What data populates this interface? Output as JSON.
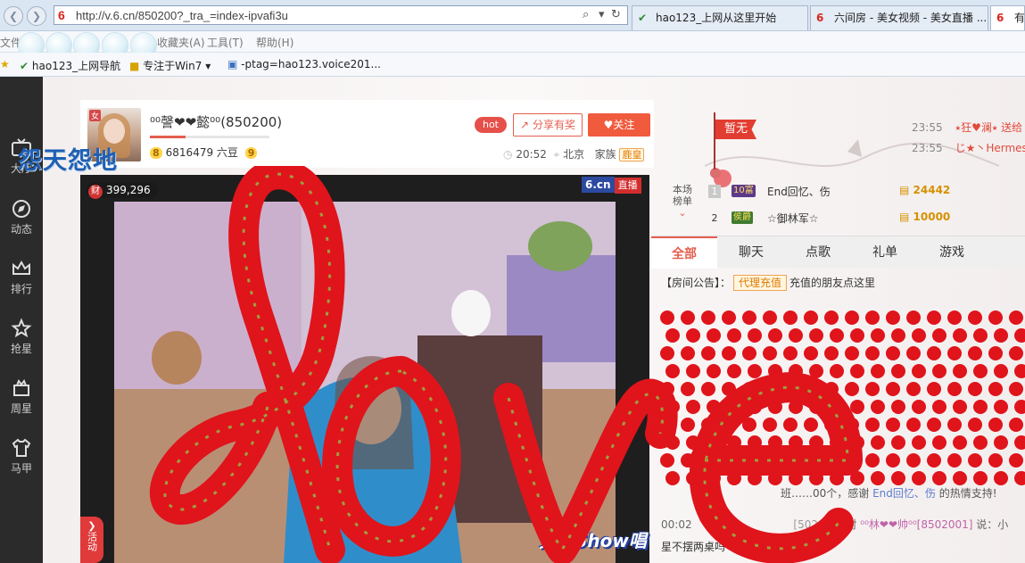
{
  "browser": {
    "url": "http://v.6.cn/850200?_tra_=index-ipvafi3u",
    "tabs": [
      {
        "icon": "hao123-icon",
        "label": "hao123_上网从这里开始"
      },
      {
        "icon": "6cn-icon",
        "label": "六间房 - 美女视频 - 美女直播 ..."
      },
      {
        "icon": "6cn-icon",
        "label": "有颜..."
      }
    ],
    "menu": {
      "file": "文件",
      "favorites": "收藏夹(A)",
      "tools": "工具(T)",
      "help": "帮助(H)"
    },
    "favorites": [
      {
        "label": "hao123_上网导航"
      },
      {
        "label": "专注于Win7"
      },
      {
        "label": "-ptag=hao123.voice201..."
      }
    ]
  },
  "overlay_watermark": "怨天怨地",
  "nav": [
    {
      "label": "大厅"
    },
    {
      "label": "动态"
    },
    {
      "label": "排行"
    },
    {
      "label": "抢星"
    },
    {
      "label": "周星"
    },
    {
      "label": "马甲"
    }
  ],
  "anchor": {
    "name": "⁰⁰謦❤❤懿⁰⁰(850200)",
    "level_left": "8",
    "level_right": "9",
    "beans": "6816479 六豆",
    "level_progress": 0.3,
    "hot": "hot",
    "share": "分享有奖",
    "follow": "关注",
    "time": "20:52",
    "location": "北京",
    "family_label": "家族",
    "family_badge": "鹿皇"
  },
  "flag_label": "暂无",
  "chat_top": [
    {
      "time": "23:55",
      "text": "⭑狂♥澜⭑ 送给"
    },
    {
      "time": "23:55",
      "text": "じ★丶Hermes..."
    }
  ],
  "video": {
    "viewers": "399,296",
    "viewer_icon": "财",
    "logo": "6.cn",
    "live": "直播",
    "activity": "活动",
    "show_logo": "秀场Show唱"
  },
  "rank": {
    "title": "本场榜单",
    "rows": [
      {
        "no": "1",
        "badge": "10富",
        "name": "End回忆、伤",
        "amount": "24442"
      },
      {
        "no": "2",
        "badge": "侯爵",
        "name": "☆御林军☆",
        "amount": "10000"
      }
    ]
  },
  "chat_tabs": [
    {
      "label": "全部"
    },
    {
      "label": "聊天"
    },
    {
      "label": "点歌"
    },
    {
      "label": "礼单"
    },
    {
      "label": "游戏"
    }
  ],
  "notice": {
    "prefix": "【房间公告】：",
    "agent": "代理充值",
    "text": "充值的朋友点这里"
  },
  "gift_line": {
    "prefix": "班……00个，感谢 ",
    "name": "End回忆、伤",
    "suffix": " 的热情支持!"
  },
  "chat_message": {
    "time": "00:02",
    "from_id": "502008",
    "to_word": "对",
    "to_name": "⁰⁰林❤❤帅⁰⁰",
    "to_id": "8502001",
    "says": "说：小"
  },
  "chat_message2": "星不摆两桌吗",
  "love_text": "love",
  "colors": {
    "accent": "#e55e4e",
    "rose": "#e0141b",
    "nav_bg": "#2b2b2b",
    "brand_blue": "#2c4aa0"
  }
}
